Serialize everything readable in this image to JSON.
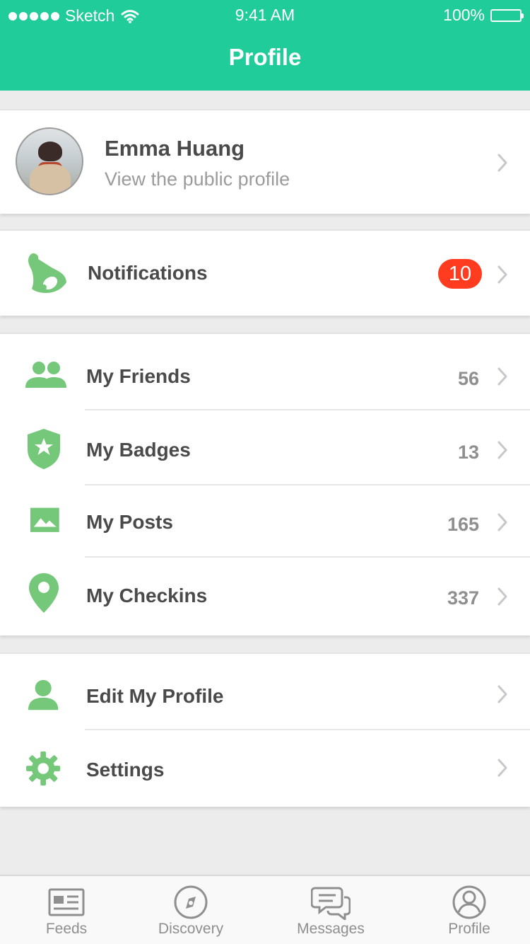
{
  "status_bar": {
    "carrier": "Sketch",
    "time": "9:41 AM",
    "battery": "100%"
  },
  "header": {
    "title": "Profile",
    "background_color": "#20cc9a"
  },
  "profile": {
    "name": "Emma Huang",
    "subtitle": "View the public profile",
    "avatar_icon": "user-photo"
  },
  "notifications": {
    "label": "Notifications",
    "badge": "10",
    "icon": "bell-icon",
    "badge_color": "#ff3b20"
  },
  "stats": [
    {
      "label": "My Friends",
      "count": "56",
      "icon": "friends-icon"
    },
    {
      "label": "My Badges",
      "count": "13",
      "icon": "badge-star-icon"
    },
    {
      "label": "My Posts",
      "count": "165",
      "icon": "image-icon"
    },
    {
      "label": "My Checkins",
      "count": "337",
      "icon": "location-pin-icon"
    }
  ],
  "account": [
    {
      "label": "Edit My Profile",
      "icon": "user-icon"
    },
    {
      "label": "Settings",
      "icon": "gear-icon"
    }
  ],
  "tabs": [
    {
      "label": "Feeds",
      "icon": "newspaper-icon"
    },
    {
      "label": "Discovery",
      "icon": "compass-icon"
    },
    {
      "label": "Messages",
      "icon": "chat-bubbles-icon"
    },
    {
      "label": "Profile",
      "icon": "profile-icon"
    }
  ],
  "colors": {
    "accent": "#20cc9a",
    "icon_green": "#75c879",
    "text_dark": "#4a4a4a",
    "text_muted": "#9b9b9b",
    "tab_gray": "#8f8f8f"
  }
}
